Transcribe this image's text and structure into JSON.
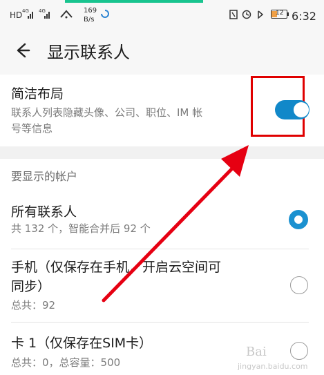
{
  "status_bar": {
    "left_items": [
      "HD",
      "4G",
      "4G",
      "169",
      "B/s"
    ],
    "right_time": "6:32",
    "battery_percent": "12"
  },
  "header": {
    "back_label": "←",
    "title": "显示联系人"
  },
  "simple_layout": {
    "title": "简洁布局",
    "description_line1": "联系人列表隐藏头像、公司、职位、IM 帐",
    "description_line2": "号等信息",
    "toggle_on": true
  },
  "accounts_section": {
    "title": "要显示的帐户",
    "items": [
      {
        "title": "所有联系人",
        "subtitle": "共 132 个，智能合并后 92 个",
        "selected": true
      },
      {
        "title": "手机（仅保存在手机，开启云空间可",
        "title_line2": "同步）",
        "subtitle": "总共：92",
        "selected": false
      },
      {
        "title": "卡 1（仅保存在SIM卡）",
        "subtitle": "总共：0，总容量：500",
        "selected": false
      }
    ]
  },
  "watermark": {
    "text1": "Bai",
    "text2": "jingyan.baidu.com"
  },
  "colors": {
    "accent": "#1188c9",
    "highlight_box": "#e00000",
    "arrow": "#e60012"
  },
  "icons": [
    "back-arrow-icon",
    "nfc-icon",
    "alarm-icon",
    "bluetooth-icon",
    "wifi-icon",
    "battery-icon",
    "radio-selected-icon",
    "radio-unselected-icon"
  ]
}
